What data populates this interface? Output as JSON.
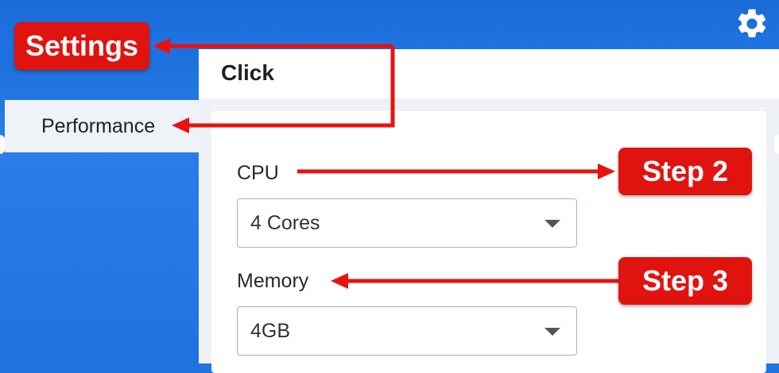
{
  "callouts": {
    "settings": "Settings",
    "step2": "Step 2",
    "step3": "Step 3"
  },
  "sidebar": {
    "items": [
      {
        "label": "Performance"
      }
    ]
  },
  "main": {
    "title": "Click"
  },
  "fields": {
    "cpu": {
      "label": "CPU",
      "value": "4 Cores"
    },
    "memory": {
      "label": "Memory",
      "value": "4GB"
    }
  },
  "icons": {
    "settings": "gear-icon",
    "dropdown": "chevron-down-icon"
  },
  "colors": {
    "accent_blue": "#1f72e0",
    "callout_red": "#e1130f",
    "arrow_red": "#e8120e"
  }
}
